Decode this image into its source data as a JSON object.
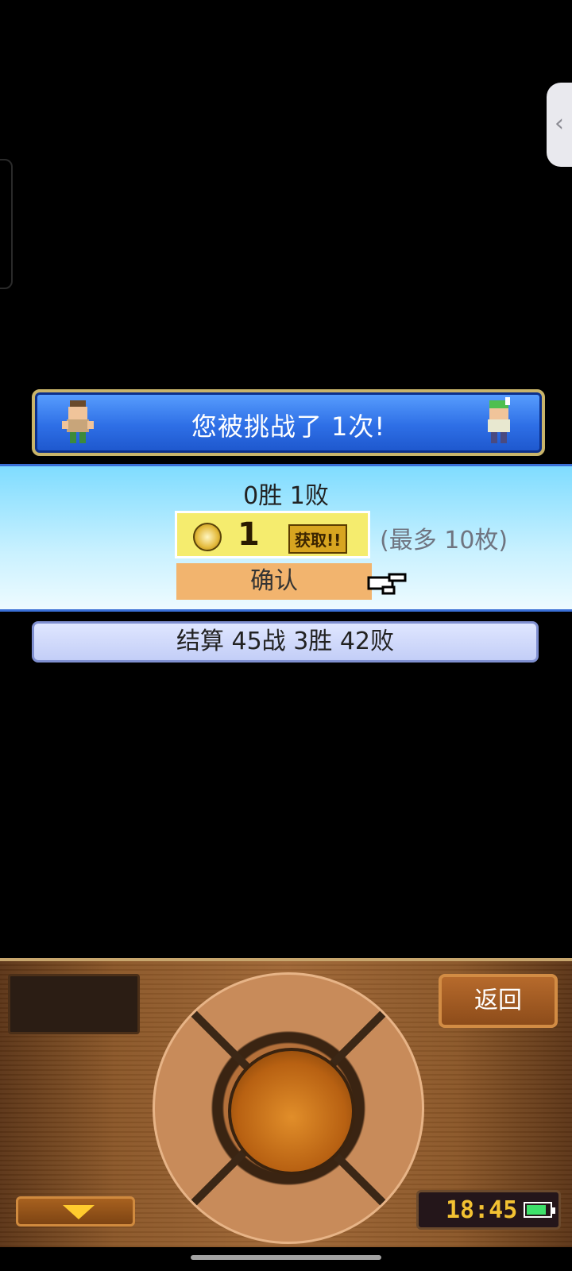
{
  "header": {
    "title": "您被挑战了 1次!"
  },
  "result": {
    "record": "0胜 1败",
    "coin_count": "1",
    "get_label": "获取!!",
    "max_note": "(最多 10枚)",
    "confirm_label": "确认"
  },
  "summary": {
    "text": "结算 45战 3胜 42败"
  },
  "console": {
    "back_label": "返回",
    "clock": "18:45"
  },
  "colors": {
    "banner_blue": "#2e6fe6",
    "panel_cyan": "#7fdcff",
    "confirm_orange": "#f2b46e",
    "coin_gold": "#e3b93a",
    "battery_green": "#3ee06a"
  }
}
